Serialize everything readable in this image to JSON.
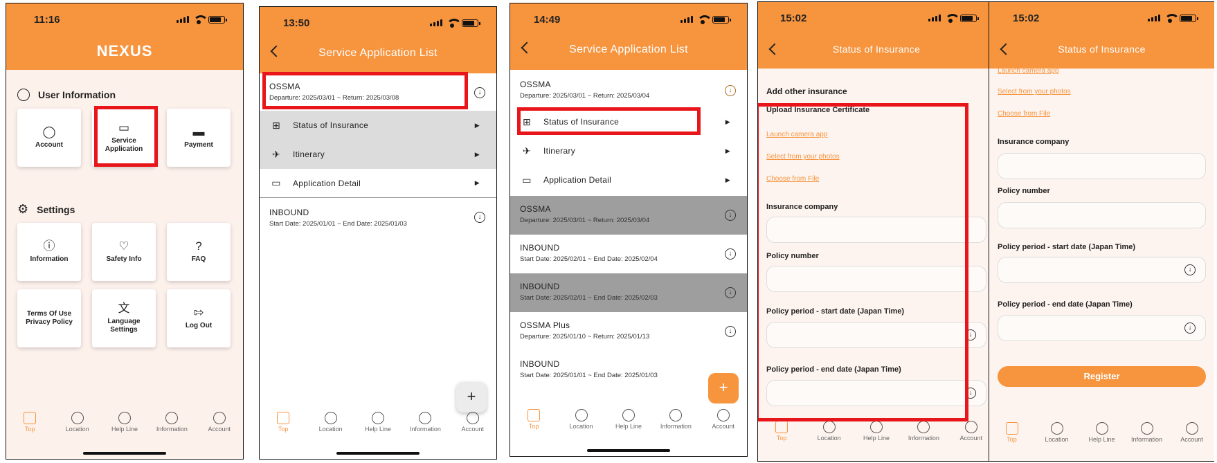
{
  "status_times": [
    "11:16",
    "13:50",
    "14:49",
    "15:02",
    "15:02"
  ],
  "tabs": [
    "Top",
    "Location",
    "Help Line",
    "Information",
    "Account"
  ],
  "accent_color": "#f7943e",
  "screen1": {
    "app_title": "NEXUS",
    "user_info_title": "User Information",
    "settings_title": "Settings",
    "tiles": [
      {
        "label": "Account",
        "icon": "person-icon"
      },
      {
        "label": "Service Application",
        "icon": "book-icon"
      },
      {
        "label": "Payment",
        "icon": "card-icon"
      },
      {
        "label": "Information",
        "icon": "info-icon"
      },
      {
        "label": "Safety Info",
        "icon": "hands-heart-icon"
      },
      {
        "label": "FAQ",
        "icon": "question-icon"
      },
      {
        "label": "Terms Of Use Privacy Policy",
        "icon": ""
      },
      {
        "label": "Language Settings",
        "icon": "translate-icon"
      },
      {
        "label": "Log Out",
        "icon": "logout-icon"
      }
    ]
  },
  "screen2": {
    "title": "Service Application List",
    "items": [
      {
        "title": "OSSMA",
        "subtitle": "Departure: 2025/03/01 ~ Return: 2025/03/08"
      },
      {
        "title": "INBOUND",
        "subtitle": "Start Date: 2025/01/01 ~ End Date: 2025/01/03"
      }
    ],
    "subitems": [
      "Status of Insurance",
      "Itinerary",
      "Application Detail"
    ],
    "fab": "+"
  },
  "screen3": {
    "title": "Service Application List",
    "items": [
      {
        "title": "OSSMA",
        "subtitle": "Departure: 2025/03/01 ~ Return: 2025/03/04"
      },
      {
        "title": "OSSMA",
        "subtitle": "Departure: 2025/03/01 ~ Return: 2025/03/04"
      },
      {
        "title": "INBOUND",
        "subtitle": "Start Date: 2025/02/01 ~ End Date: 2025/02/04"
      },
      {
        "title": "INBOUND",
        "subtitle": "Start Date: 2025/02/01 ~ End Date: 2025/02/03"
      },
      {
        "title": "OSSMA Plus",
        "subtitle": "Departure: 2025/01/10 ~ Return: 2025/01/13"
      },
      {
        "title": "INBOUND",
        "subtitle": "Start Date: 2025/01/01 ~ End Date: 2025/01/03"
      }
    ],
    "subitems": [
      "Status of Insurance",
      "Itinerary",
      "Application Detail"
    ],
    "fab": "+"
  },
  "screen4": {
    "title": "Status of Insurance",
    "add_other": "Add other insurance",
    "upload_title": "Upload Insurance Certificate",
    "links": [
      "Launch camera app",
      "Select from your photos",
      "Choose from File"
    ],
    "labels": [
      "Insurance company",
      "Policy number",
      "Policy period - start date (Japan Time)",
      "Policy period - end date (Japan Time)"
    ]
  },
  "screen5": {
    "title": "Status of Insurance",
    "links": [
      "Launch camera app",
      "Select from your photos",
      "Choose from File"
    ],
    "labels": [
      "Insurance company",
      "Policy number",
      "Policy period - start date (Japan Time)",
      "Policy period - end date (Japan Time)"
    ],
    "register": "Register"
  }
}
